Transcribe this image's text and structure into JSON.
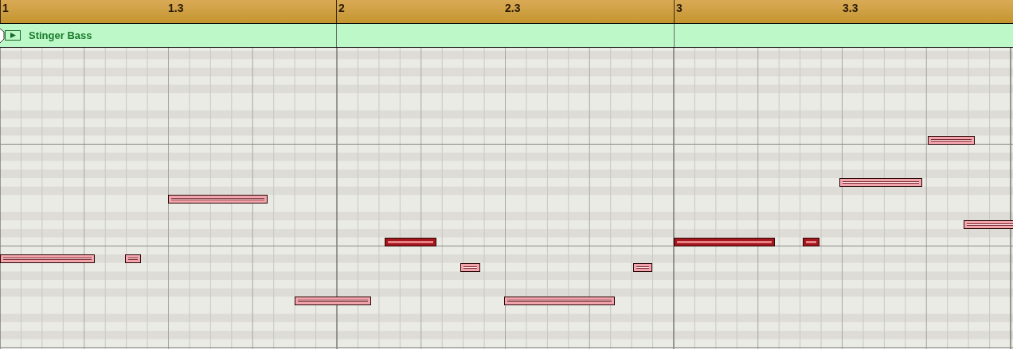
{
  "ruler": {
    "markers": [
      {
        "label": "1",
        "kind": "bar"
      },
      {
        "label": "1.3",
        "kind": "beat"
      },
      {
        "label": "2",
        "kind": "bar"
      },
      {
        "label": "2.3",
        "kind": "beat"
      },
      {
        "label": "3",
        "kind": "bar"
      },
      {
        "label": "3.3",
        "kind": "beat"
      }
    ]
  },
  "region": {
    "name": "Stinger Bass"
  },
  "notes": [
    {
      "selected": false
    },
    {
      "selected": false
    },
    {
      "selected": false
    },
    {
      "selected": false
    },
    {
      "selected": true
    },
    {
      "selected": false
    },
    {
      "selected": false
    },
    {
      "selected": false
    },
    {
      "selected": true
    },
    {
      "selected": true
    },
    {
      "selected": false
    },
    {
      "selected": false
    },
    {
      "selected": false
    }
  ]
}
